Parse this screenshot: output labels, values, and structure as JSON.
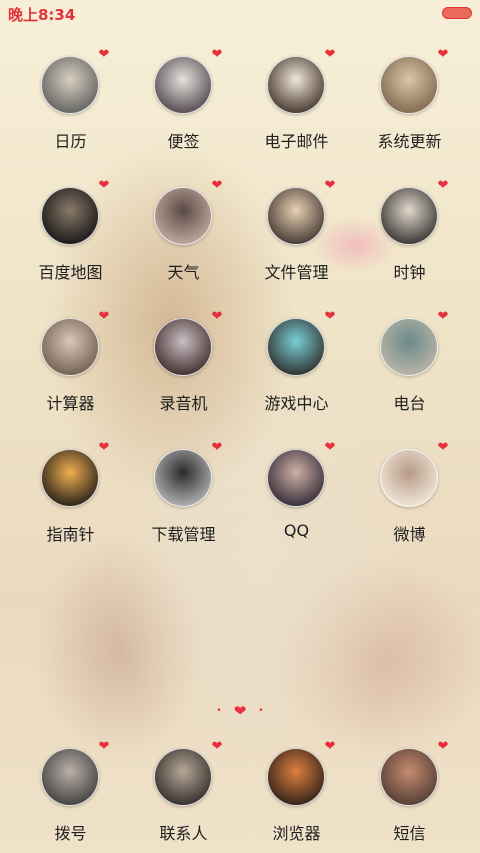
{
  "status_bar": {
    "time": "晚上8:34"
  },
  "apps": [
    {
      "label": "日历",
      "icon": "calendar-icon",
      "colors": [
        "#5a5a5a",
        "#d8d0c0"
      ]
    },
    {
      "label": "便签",
      "icon": "notes-icon",
      "colors": [
        "#4a4048",
        "#e6e2dc"
      ]
    },
    {
      "label": "电子邮件",
      "icon": "email-icon",
      "colors": [
        "#3a2c24",
        "#f0e6da"
      ]
    },
    {
      "label": "系统更新",
      "icon": "system-update-icon",
      "colors": [
        "#7a6248",
        "#d9c8a8"
      ]
    },
    {
      "label": "百度地图",
      "icon": "map-icon",
      "colors": [
        "#101010",
        "#8a7a6a"
      ]
    },
    {
      "label": "天气",
      "icon": "weather-icon",
      "colors": [
        "#c8b0a8",
        "#5a4a44"
      ]
    },
    {
      "label": "文件管理",
      "icon": "file-manager-icon",
      "colors": [
        "#3a2e2a",
        "#e8d2b4"
      ]
    },
    {
      "label": "时钟",
      "icon": "clock-icon",
      "colors": [
        "#2e2a28",
        "#e0d8cc"
      ]
    },
    {
      "label": "计算器",
      "icon": "calculator-icon",
      "colors": [
        "#6a5848",
        "#d8c8b8"
      ]
    },
    {
      "label": "录音机",
      "icon": "recorder-icon",
      "colors": [
        "#3a2424",
        "#c8c0c4"
      ]
    },
    {
      "label": "游戏中心",
      "icon": "game-center-icon",
      "colors": [
        "#2a2420",
        "#7ad0d8"
      ]
    },
    {
      "label": "电台",
      "icon": "radio-icon",
      "colors": [
        "#c0b8a8",
        "#6a8a8a"
      ]
    },
    {
      "label": "指南针",
      "icon": "compass-icon",
      "colors": [
        "#1a1616",
        "#f0b050"
      ]
    },
    {
      "label": "下载管理",
      "icon": "download-manager-icon",
      "colors": [
        "#bcbcbc",
        "#2a2a2a"
      ]
    },
    {
      "label": "QQ",
      "icon": "qq-icon",
      "colors": [
        "#2a2430",
        "#d0b0a8"
      ]
    },
    {
      "label": "微博",
      "icon": "weibo-icon",
      "colors": [
        "#f4ecdc",
        "#b89a88"
      ]
    }
  ],
  "dock": [
    {
      "label": "拨号",
      "icon": "phone-icon",
      "colors": [
        "#3a3a3a",
        "#bab0a8"
      ]
    },
    {
      "label": "联系人",
      "icon": "contacts-icon",
      "colors": [
        "#2a2624",
        "#b8a898"
      ]
    },
    {
      "label": "浏览器",
      "icon": "browser-icon",
      "colors": [
        "#241a16",
        "#e08040"
      ]
    },
    {
      "label": "短信",
      "icon": "sms-icon",
      "colors": [
        "#4a3a30",
        "#c88a70"
      ]
    }
  ],
  "page_indicator": {
    "pages": 3,
    "current": 2
  }
}
